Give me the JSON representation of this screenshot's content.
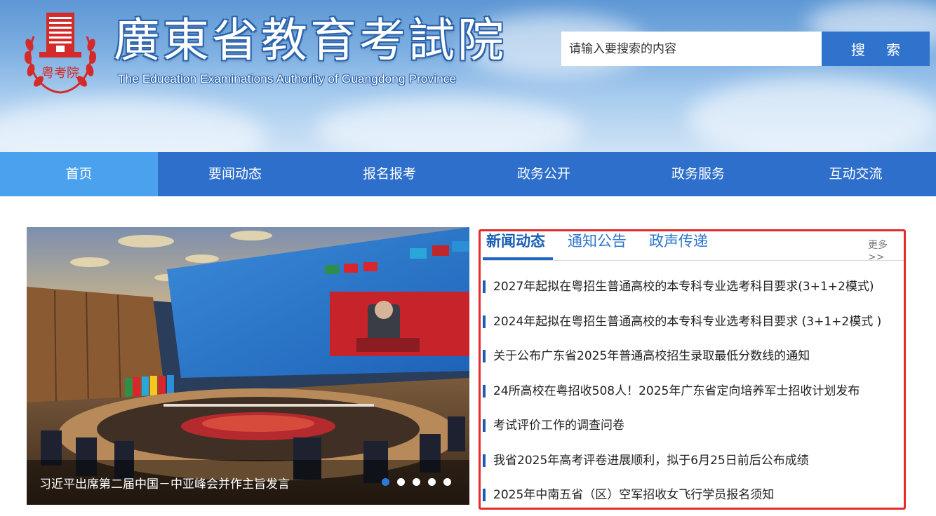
{
  "header": {
    "title": "廣東省教育考試院",
    "subtitle": "The Education Examinations Authority of Guangdong Province",
    "emblem_text": "粤考院"
  },
  "search": {
    "placeholder": "请输入要搜索的内容",
    "button_label": "搜 索"
  },
  "nav": {
    "items": [
      {
        "label": "首页",
        "active": true
      },
      {
        "label": "要闻动态"
      },
      {
        "label": "报名报考"
      },
      {
        "label": "政务公开"
      },
      {
        "label": "政务服务"
      },
      {
        "label": "互动交流"
      }
    ]
  },
  "carousel": {
    "caption": "习近平出席第二届中国－中亚峰会并作主旨发言",
    "slide_count": 5,
    "active_index": 0
  },
  "news": {
    "tabs": [
      {
        "label": "新闻动态",
        "active": true
      },
      {
        "label": "通知公告"
      },
      {
        "label": "政声传递"
      }
    ],
    "more_label": "更多>>",
    "items": [
      "2027年起拟在粤招生普通高校的本专科专业选考科目要求(3+1+2模式)",
      "2024年起拟在粤招生普通高校的本专科专业选考科目要求 (3+1+2模式 )",
      "关于公布广东省2025年普通高校招生录取最低分数线的通知",
      "24所高校在粤招收508人！2025年广东省定向培养军士招收计划发布",
      "考试评价工作的调查问卷",
      "我省2025年高考评卷进展顺利，拟于6月25日前后公布成绩",
      "2025年中南五省（区）空军招收女飞行学员报名须知"
    ]
  },
  "colors": {
    "nav_bg": "#2f6fcc",
    "nav_active": "#4aa1ee",
    "panel_border": "#e42a2a",
    "accent": "#1d5bb4"
  }
}
